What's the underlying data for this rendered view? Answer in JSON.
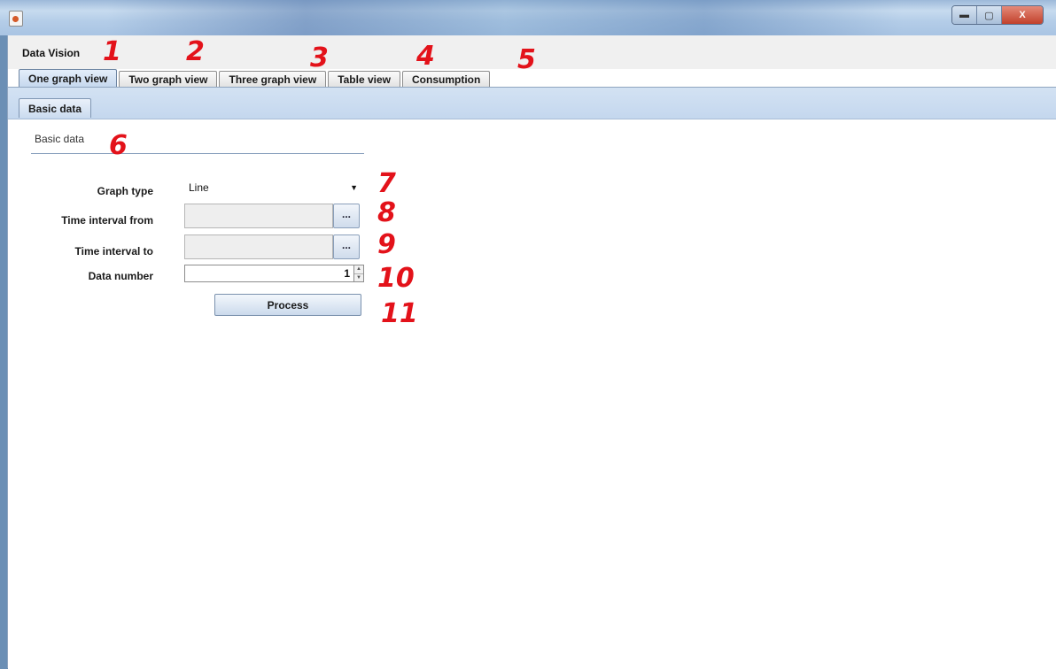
{
  "window": {
    "app_name": "Data Vision",
    "controls": {
      "minimize": "▬",
      "maximize": "▢",
      "close": "X"
    }
  },
  "tabs": [
    {
      "label": "One graph view",
      "active": true
    },
    {
      "label": "Two graph view",
      "active": false
    },
    {
      "label": "Three graph view",
      "active": false
    },
    {
      "label": "Table view",
      "active": false
    },
    {
      "label": "Consumption",
      "active": false
    }
  ],
  "subtabs": [
    {
      "label": "Basic data",
      "active": true
    }
  ],
  "form": {
    "section_title": "Basic data",
    "graph_type": {
      "label": "Graph type",
      "value": "Line"
    },
    "time_from": {
      "label": "Time interval from",
      "value": "",
      "button": "..."
    },
    "time_to": {
      "label": "Time interval to",
      "value": "",
      "button": "..."
    },
    "data_number": {
      "label": "Data number",
      "value": "1"
    },
    "process_button": "Process"
  },
  "callouts": [
    "1",
    "2",
    "3",
    "4",
    "5",
    "6",
    "7",
    "8",
    "9",
    "10",
    "11"
  ],
  "colors": {
    "callout": "#e3121a",
    "accent_tab": "#c6d8ee"
  }
}
